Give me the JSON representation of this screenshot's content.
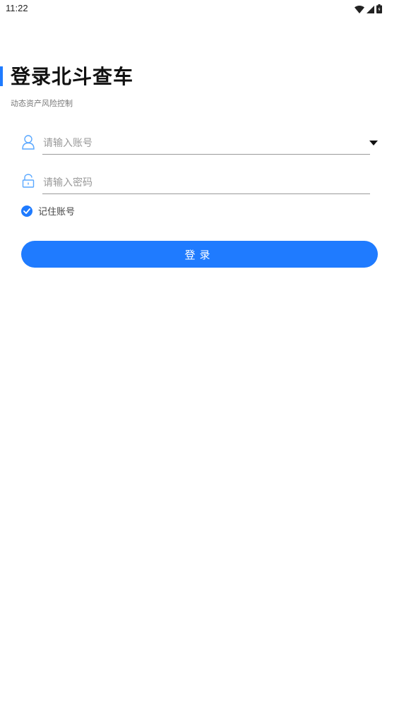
{
  "status_bar": {
    "time": "11:22",
    "icons": [
      "wifi-icon",
      "cellular-signal-icon",
      "battery-icon"
    ]
  },
  "header": {
    "title": "登录北斗查车",
    "subtitle": "动态资产风险控制"
  },
  "form": {
    "account": {
      "placeholder": "请输入账号",
      "value": "",
      "icon": "user-icon"
    },
    "password": {
      "placeholder": "请输入密码",
      "value": "",
      "icon": "lock-icon"
    },
    "remember": {
      "label": "记住账号",
      "checked": true
    },
    "login_label": "登录"
  },
  "colors": {
    "accent": "#1f7bff",
    "input_icon": "#5aa8ff"
  }
}
